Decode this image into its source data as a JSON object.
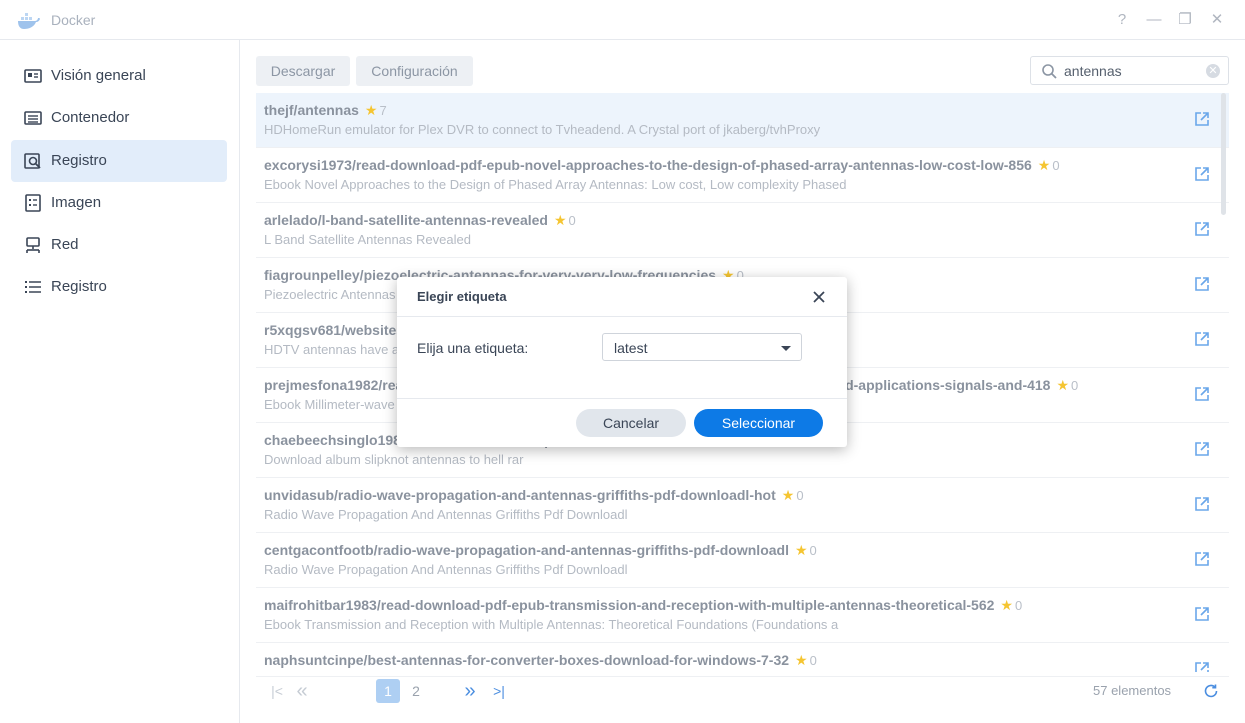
{
  "window": {
    "title": "Docker",
    "controls": [
      "?",
      "—",
      "❐",
      "✕"
    ]
  },
  "sidebar": {
    "items": [
      {
        "label": "Visión general",
        "icon": "overview-icon"
      },
      {
        "label": "Contenedor",
        "icon": "container-icon"
      },
      {
        "label": "Registro",
        "icon": "registry-search-icon",
        "active": true
      },
      {
        "label": "Imagen",
        "icon": "image-icon"
      },
      {
        "label": "Red",
        "icon": "network-icon"
      },
      {
        "label": "Registro",
        "icon": "log-list-icon"
      }
    ]
  },
  "toolbar": {
    "download_label": "Descargar",
    "settings_label": "Configuración",
    "search_value": "antennas"
  },
  "results": [
    {
      "name": "thejf/antennas",
      "stars": "7",
      "desc": "HDHomeRun emulator for Plex DVR to connect to Tvheadend. A Crystal port of jkaberg/tvhProxy"
    },
    {
      "name": "excorysi1973/read-download-pdf-epub-novel-approaches-to-the-design-of-phased-array-antennas-low-cost-low-856",
      "stars": "0",
      "desc": "Ebook Novel Approaches to the Design of Phased Array Antennas: Low cost, Low complexity Phased"
    },
    {
      "name": "arlelado/l-band-satellite-antennas-revealed",
      "stars": "0",
      "desc": "L Band Satellite Antennas Revealed"
    },
    {
      "name": "fiagrounpelley/piezoelectric-antennas-for-very-very-low-frequencies",
      "stars": "0",
      "desc": "Piezoelectric Antennas for Very Very Low Frequencies"
    },
    {
      "name": "r5xqgsv681/websites-hdtv-antennas-have-a-reputation",
      "stars": "0",
      "desc": "HDTV antennas have a reputation for being difficult to set up, but most modern antennas just connect"
    },
    {
      "name": "prejmesfona1982/read-download-pdf-epub-millimeter-wave-antennas-configurations-and-applications-signals-and-418",
      "stars": "0",
      "desc": "Ebook Millimeter-wave Antennas: Configurations and Applications (Signals and Communication Tech"
    },
    {
      "name": "chaebeechsinglo1984/download-album-slipknot-antennas-to-hell-rar",
      "stars": "0",
      "desc": "Download album slipknot antennas to hell rar"
    },
    {
      "name": "unvidasub/radio-wave-propagation-and-antennas-griffiths-pdf-downloadl-hot",
      "stars": "0",
      "desc": "Radio Wave Propagation And Antennas Griffiths Pdf Downloadl"
    },
    {
      "name": "centgacontfootb/radio-wave-propagation-and-antennas-griffiths-pdf-downloadl",
      "stars": "0",
      "desc": "Radio Wave Propagation And Antennas Griffiths Pdf Downloadl"
    },
    {
      "name": "maifrohitbar1983/read-download-pdf-epub-transmission-and-reception-with-multiple-antennas-theoretical-562",
      "stars": "0",
      "desc": "Ebook Transmission and Reception with Multiple Antennas: Theoretical Foundations (Foundations a"
    },
    {
      "name": "naphsuntcinpe/best-antennas-for-converter-boxes-download-for-windows-7-32",
      "stars": "0",
      "desc": ""
    }
  ],
  "pager": {
    "first": "|<",
    "prev": "«",
    "page1": "1",
    "page2": "2",
    "next": "»",
    "last": ">|",
    "count": "57 elementos"
  },
  "dialog": {
    "title": "Elegir etiqueta",
    "label": "Elija una etiqueta:",
    "selected_tag": "latest",
    "cancel_label": "Cancelar",
    "ok_label": "Seleccionar"
  },
  "colors": {
    "accent": "#0d7ae6",
    "active_nav": "#e2edfa",
    "star": "#f5c531",
    "link_icon": "#6aa7ea"
  }
}
